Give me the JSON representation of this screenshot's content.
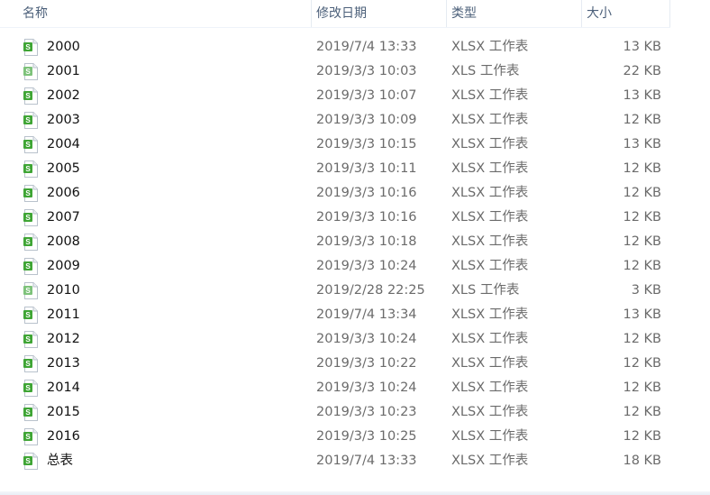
{
  "header": {
    "name": "名称",
    "date": "修改日期",
    "type": "类型",
    "size": "大小"
  },
  "files": [
    {
      "name": "2000",
      "date": "2019/7/4 13:33",
      "type": "XLSX 工作表",
      "size": "13 KB",
      "icon": "xlsx-file-icon"
    },
    {
      "name": "2001",
      "date": "2019/3/3 10:03",
      "type": "XLS 工作表",
      "size": "22 KB",
      "icon": "xls-file-icon"
    },
    {
      "name": "2002",
      "date": "2019/3/3 10:07",
      "type": "XLSX 工作表",
      "size": "13 KB",
      "icon": "xlsx-file-icon"
    },
    {
      "name": "2003",
      "date": "2019/3/3 10:09",
      "type": "XLSX 工作表",
      "size": "12 KB",
      "icon": "xlsx-file-icon"
    },
    {
      "name": "2004",
      "date": "2019/3/3 10:15",
      "type": "XLSX 工作表",
      "size": "13 KB",
      "icon": "xlsx-file-icon"
    },
    {
      "name": "2005",
      "date": "2019/3/3 10:11",
      "type": "XLSX 工作表",
      "size": "12 KB",
      "icon": "xlsx-file-icon"
    },
    {
      "name": "2006",
      "date": "2019/3/3 10:16",
      "type": "XLSX 工作表",
      "size": "12 KB",
      "icon": "xlsx-file-icon"
    },
    {
      "name": "2007",
      "date": "2019/3/3 10:16",
      "type": "XLSX 工作表",
      "size": "12 KB",
      "icon": "xlsx-file-icon"
    },
    {
      "name": "2008",
      "date": "2019/3/3 10:18",
      "type": "XLSX 工作表",
      "size": "12 KB",
      "icon": "xlsx-file-icon"
    },
    {
      "name": "2009",
      "date": "2019/3/3 10:24",
      "type": "XLSX 工作表",
      "size": "12 KB",
      "icon": "xlsx-file-icon"
    },
    {
      "name": "2010",
      "date": "2019/2/28 22:25",
      "type": "XLS 工作表",
      "size": "3 KB",
      "icon": "xls-file-icon"
    },
    {
      "name": "2011",
      "date": "2019/7/4 13:34",
      "type": "XLSX 工作表",
      "size": "13 KB",
      "icon": "xlsx-file-icon"
    },
    {
      "name": "2012",
      "date": "2019/3/3 10:24",
      "type": "XLSX 工作表",
      "size": "12 KB",
      "icon": "xlsx-file-icon"
    },
    {
      "name": "2013",
      "date": "2019/3/3 10:22",
      "type": "XLSX 工作表",
      "size": "12 KB",
      "icon": "xlsx-file-icon"
    },
    {
      "name": "2014",
      "date": "2019/3/3 10:24",
      "type": "XLSX 工作表",
      "size": "12 KB",
      "icon": "xlsx-file-icon"
    },
    {
      "name": "2015",
      "date": "2019/3/3 10:23",
      "type": "XLSX 工作表",
      "size": "12 KB",
      "icon": "xlsx-file-icon"
    },
    {
      "name": "2016",
      "date": "2019/3/3 10:25",
      "type": "XLSX 工作表",
      "size": "12 KB",
      "icon": "xlsx-file-icon"
    },
    {
      "name": "总表",
      "date": "2019/7/4 13:33",
      "type": "XLSX 工作表",
      "size": "18 KB",
      "icon": "xlsx-file-icon"
    }
  ],
  "colors": {
    "icon_green": "#3fa535",
    "icon_light_green": "#7dc27a"
  }
}
